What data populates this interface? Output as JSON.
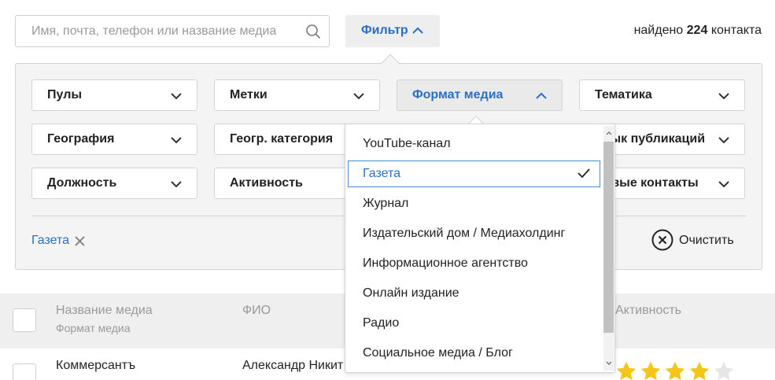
{
  "search": {
    "placeholder": "Имя, почта, телефон или название медиа"
  },
  "filter_button": {
    "label": "Фильтр"
  },
  "found": {
    "prefix": "найдено",
    "count": "224",
    "suffix": "контакта"
  },
  "filters": {
    "pools": "Пулы",
    "tags": "Метки",
    "media_format": "Формат медиа",
    "topic": "Тематика",
    "geography": "География",
    "geo_category": "Геогр. категория",
    "publication_language": "Язык публикаций",
    "position": "Должность",
    "activity": "Активность",
    "new_contacts": "Новые контакты"
  },
  "active_tags": [
    {
      "label": "Газета"
    }
  ],
  "clear": {
    "label": "Очистить"
  },
  "table": {
    "header": {
      "media_name": "Название медиа",
      "media_format": "Формат медиа",
      "fio": "ФИО",
      "activity": "Активность"
    },
    "rows": [
      {
        "media_name": "Коммерсантъ",
        "fio": "Александр Никит",
        "rating": 4,
        "max_rating": 5
      }
    ]
  },
  "media_format_menu": {
    "options": [
      {
        "label": "YouTube-канал",
        "selected": false
      },
      {
        "label": "Газета",
        "selected": true
      },
      {
        "label": "Журнал",
        "selected": false
      },
      {
        "label": "Издательский дом / Медиахолдинг",
        "selected": false
      },
      {
        "label": "Информационное агентство",
        "selected": false
      },
      {
        "label": "Онлайн издание",
        "selected": false
      },
      {
        "label": "Радио",
        "selected": false
      },
      {
        "label": "Социальное медиа / Блог",
        "selected": false
      }
    ]
  },
  "colors": {
    "accent": "#2a6fc4",
    "star": "#f5c518",
    "star_empty": "#e6e6e6"
  }
}
